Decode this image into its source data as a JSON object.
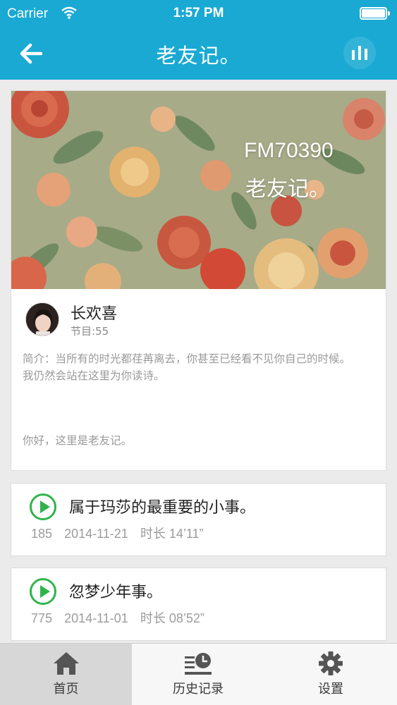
{
  "status_bar": {
    "carrier": "Carrier",
    "time": "1:57 PM"
  },
  "nav": {
    "title": "老友记。",
    "back_icon": "arrow-left-icon",
    "player_icon": "equalizer-icon"
  },
  "program": {
    "cover_line1": "FM70390",
    "cover_line2": "老友记。",
    "host_name": "长欢喜",
    "episode_count": "节目:55",
    "intro_line1": "简介：当所有的时光都荏苒离去，你甚至已经看不见你自己的时候。",
    "intro_line2": "我仍然会站在这里为你读诗。",
    "greeting": "你好，这里是老友记。"
  },
  "episodes": [
    {
      "title": "属于玛莎的最重要的小事。",
      "plays": "185",
      "date": "2014-11-21",
      "duration": "时长 14’11”"
    },
    {
      "title": "忽梦少年事。",
      "plays": "775",
      "date": "2014-11-01",
      "duration": "时长 08’52”"
    }
  ],
  "tabs": [
    {
      "label": "首页",
      "icon": "home-icon",
      "active": true
    },
    {
      "label": "历史记录",
      "icon": "history-icon",
      "active": false
    },
    {
      "label": "设置",
      "icon": "gear-icon",
      "active": false
    }
  ],
  "colors": {
    "nav_bar": "#19a9d3",
    "play_accent": "#2fb34a",
    "background": "#ebebeb"
  }
}
